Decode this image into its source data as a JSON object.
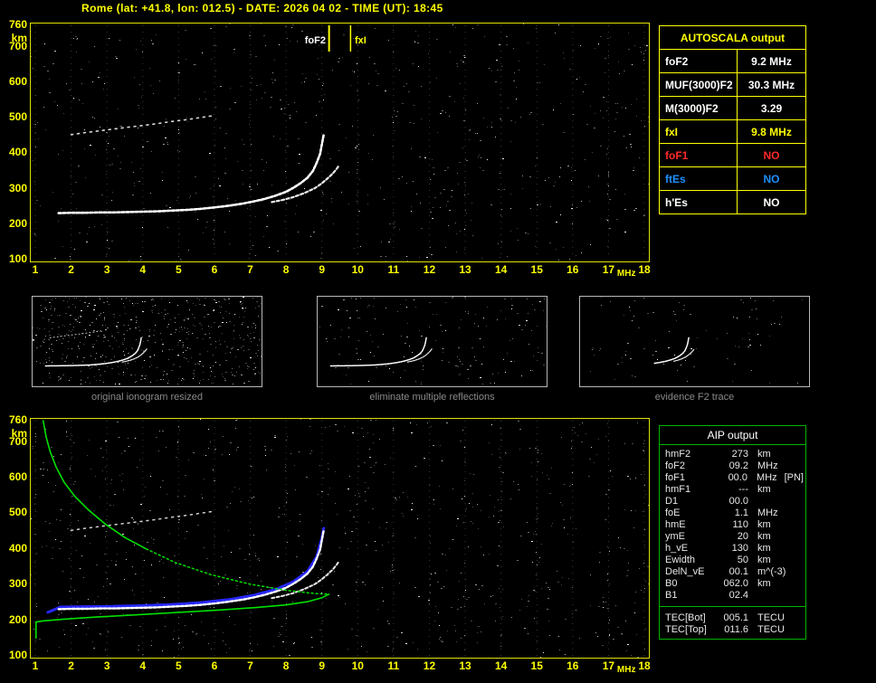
{
  "title": "Rome (lat: +41.8, lon: 012.5) - DATE: 2026 04 02 - TIME (UT): 18:45",
  "colors": {
    "accent_yellow": "#ffff00",
    "accent_green": "#00b400",
    "status_red": "#ff2a2a",
    "status_blue": "#1e90ff",
    "trace_white": "#ffffff",
    "fit_blue": "#2828ff",
    "profile_green": "#00e000"
  },
  "autoscala_table": {
    "header": "AUTOSCALA output",
    "rows": [
      {
        "label": "foF2",
        "value": "9.2 MHz",
        "color": "white"
      },
      {
        "label": "MUF(3000)F2",
        "value": "30.3 MHz",
        "color": "white"
      },
      {
        "label": "M(3000)F2",
        "value": "3.29",
        "color": "white"
      },
      {
        "label": "fxI",
        "value": "9.8 MHz",
        "color": "yellow"
      },
      {
        "label": "foF1",
        "value": "NO",
        "color": "red"
      },
      {
        "label": "ftEs",
        "value": "NO",
        "color": "blue"
      },
      {
        "label": "h'Es",
        "value": "NO",
        "color": "white"
      }
    ]
  },
  "aip_table": {
    "header": "AIP output",
    "rows": [
      {
        "label": "hmF2",
        "value": "273",
        "unit": "km",
        "extra": ""
      },
      {
        "label": "foF2",
        "value": "09.2",
        "unit": "MHz",
        "extra": ""
      },
      {
        "label": "foF1",
        "value": "00.0",
        "unit": "MHz",
        "extra": "[PN]"
      },
      {
        "label": "hmF1",
        "value": "---",
        "unit": "km",
        "extra": ""
      },
      {
        "label": "D1",
        "value": "00.0",
        "unit": "",
        "extra": ""
      },
      {
        "label": "foE",
        "value": "1.1",
        "unit": "MHz",
        "extra": ""
      },
      {
        "label": "hmE",
        "value": "110",
        "unit": "km",
        "extra": ""
      },
      {
        "label": "ymE",
        "value": "20",
        "unit": "km",
        "extra": ""
      },
      {
        "label": "h_vE",
        "value": "130",
        "unit": "km",
        "extra": ""
      },
      {
        "label": "Ewidth",
        "value": "50",
        "unit": "km",
        "extra": ""
      },
      {
        "label": "DelN_vE",
        "value": "00.1",
        "unit": "m^(-3)",
        "extra": ""
      },
      {
        "label": "B0",
        "value": "062.0",
        "unit": "km",
        "extra": ""
      },
      {
        "label": "B1",
        "value": "02.4",
        "unit": "",
        "extra": ""
      }
    ],
    "tec_rows": [
      {
        "label": "TEC[Bot]",
        "value": "005.1",
        "unit": "TECU"
      },
      {
        "label": "TEC[Top]",
        "value": "011.6",
        "unit": "TECU"
      }
    ]
  },
  "thumbnails": [
    {
      "caption": "original ionogram resized"
    },
    {
      "caption": "eliminate multiple reflections"
    },
    {
      "caption": "evidence F2 trace"
    }
  ],
  "axes": {
    "y_ticks": [
      760,
      700,
      600,
      500,
      400,
      300,
      200,
      100
    ],
    "y_unit": "km",
    "x_ticks": [
      1,
      2,
      3,
      4,
      5,
      6,
      7,
      8,
      9,
      10,
      11,
      12,
      13,
      14,
      15,
      16,
      17,
      18
    ],
    "x_unit": "MHz"
  },
  "markers": {
    "foF2": {
      "label": "foF2",
      "mhz": 9.2
    },
    "fxI": {
      "label": "fxI",
      "mhz": 9.8
    }
  },
  "chart_data": {
    "type": "scatter",
    "description": "Ionogram echo traces: virtual height (km) vs sounding frequency (MHz). Rendered twice: raw (top) and with AIP electron-density profile overlay (bottom).",
    "xlabel": "MHz",
    "ylabel": "km",
    "x_range": [
      1,
      18
    ],
    "y_range": [
      100,
      760
    ],
    "grid": "faint vertical dotted lines at each MHz",
    "traces": {
      "f_trace_o_mode": [
        [
          1.65,
          231
        ],
        [
          2.0,
          232
        ],
        [
          2.4,
          232
        ],
        [
          2.8,
          233
        ],
        [
          3.2,
          233
        ],
        [
          3.6,
          234
        ],
        [
          4.0,
          235
        ],
        [
          4.4,
          236
        ],
        [
          4.8,
          238
        ],
        [
          5.2,
          240
        ],
        [
          5.6,
          243
        ],
        [
          6.0,
          247
        ],
        [
          6.4,
          252
        ],
        [
          6.8,
          258
        ],
        [
          7.1,
          264
        ],
        [
          7.4,
          271
        ],
        [
          7.7,
          280
        ],
        [
          8.0,
          291
        ],
        [
          8.2,
          302
        ],
        [
          8.4,
          315
        ],
        [
          8.6,
          331
        ],
        [
          8.75,
          350
        ],
        [
          8.85,
          372
        ],
        [
          8.95,
          398
        ],
        [
          9.0,
          425
        ],
        [
          9.05,
          452
        ]
      ],
      "f_trace_x_mode": [
        [
          7.6,
          262
        ],
        [
          7.9,
          268
        ],
        [
          8.2,
          276
        ],
        [
          8.5,
          287
        ],
        [
          8.8,
          301
        ],
        [
          9.0,
          315
        ],
        [
          9.15,
          328
        ],
        [
          9.3,
          342
        ],
        [
          9.4,
          354
        ],
        [
          9.47,
          364
        ]
      ],
      "second_hop": [
        [
          2.0,
          452
        ],
        [
          2.4,
          458
        ],
        [
          2.8,
          463
        ],
        [
          3.2,
          468
        ],
        [
          3.6,
          473
        ],
        [
          4.0,
          478
        ],
        [
          4.4,
          483
        ],
        [
          4.8,
          489
        ],
        [
          5.2,
          494
        ],
        [
          5.6,
          500
        ],
        [
          6.0,
          506
        ]
      ],
      "fitted_trace_blue": [
        [
          1.35,
          222
        ],
        [
          1.7,
          237
        ],
        [
          2.4,
          238
        ],
        [
          3.2,
          239
        ],
        [
          4.0,
          241
        ],
        [
          4.8,
          244
        ],
        [
          5.6,
          249
        ],
        [
          6.4,
          258
        ],
        [
          7.1,
          270
        ],
        [
          7.7,
          286
        ],
        [
          8.2,
          308
        ],
        [
          8.6,
          337
        ],
        [
          8.85,
          378
        ],
        [
          9.0,
          431
        ],
        [
          9.05,
          458
        ]
      ],
      "profile_topside": [
        [
          1.22,
          760
        ],
        [
          1.3,
          715
        ],
        [
          1.42,
          672
        ],
        [
          1.58,
          630
        ],
        [
          1.8,
          588
        ],
        [
          2.1,
          548
        ],
        [
          2.5,
          508
        ],
        [
          2.95,
          470
        ],
        [
          3.5,
          432
        ],
        [
          4.1,
          400
        ]
      ],
      "profile_mid_dotted": [
        [
          4.1,
          400
        ],
        [
          4.9,
          362
        ],
        [
          5.9,
          328
        ],
        [
          7.0,
          301
        ],
        [
          8.0,
          284
        ],
        [
          8.8,
          275
        ],
        [
          9.2,
          273
        ]
      ],
      "profile_bottomside": [
        [
          9.2,
          273
        ],
        [
          9.0,
          263
        ],
        [
          8.6,
          252
        ],
        [
          8.0,
          243
        ],
        [
          7.2,
          236
        ],
        [
          6.2,
          229
        ],
        [
          5.0,
          222
        ],
        [
          3.8,
          215
        ],
        [
          2.7,
          209
        ],
        [
          1.8,
          203
        ],
        [
          1.2,
          198
        ],
        [
          1.02,
          195
        ]
      ],
      "profile_e_region": [
        [
          1.02,
          195
        ],
        [
          1.02,
          150
        ]
      ]
    }
  }
}
